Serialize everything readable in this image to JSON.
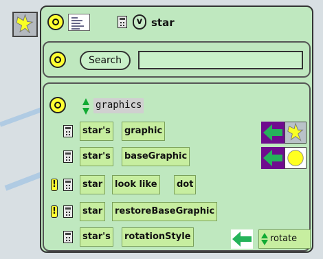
{
  "window": {
    "title": "star",
    "menu_glyph": "v",
    "thumbnail_icon": "star-icon",
    "mini_thumb_icon": "scripts-thumb-icon",
    "viewer_icon": "calculator-icon"
  },
  "search": {
    "label": "Search",
    "value": ""
  },
  "category": {
    "name": "graphics",
    "rows": [
      {
        "has_warning": false,
        "tiles": [
          "star's",
          "graphic"
        ],
        "value_preview": "star-thumb",
        "assign_icon": "left-arrow-icon"
      },
      {
        "has_warning": false,
        "tiles": [
          "star's",
          "baseGraphic"
        ],
        "value_preview": "yellow-dot",
        "assign_icon": "left-arrow-icon"
      },
      {
        "has_warning": true,
        "tiles": [
          "star",
          "look like",
          "dot"
        ]
      },
      {
        "has_warning": true,
        "tiles": [
          "star",
          "restoreBaseGraphic"
        ]
      },
      {
        "has_warning": false,
        "tiles": [
          "star's",
          "rotationStyle"
        ],
        "value": "rotate",
        "assign_icon": "left-arrow-icon"
      }
    ]
  },
  "colors": {
    "background": "#d8dfe3",
    "viewer_bg": "#bfe8bf",
    "tile_bg": "#c7eea0",
    "button_yellow": "#ffff32",
    "arrow_purple": "#6f0c8e",
    "arrow_green": "#25b35a"
  }
}
